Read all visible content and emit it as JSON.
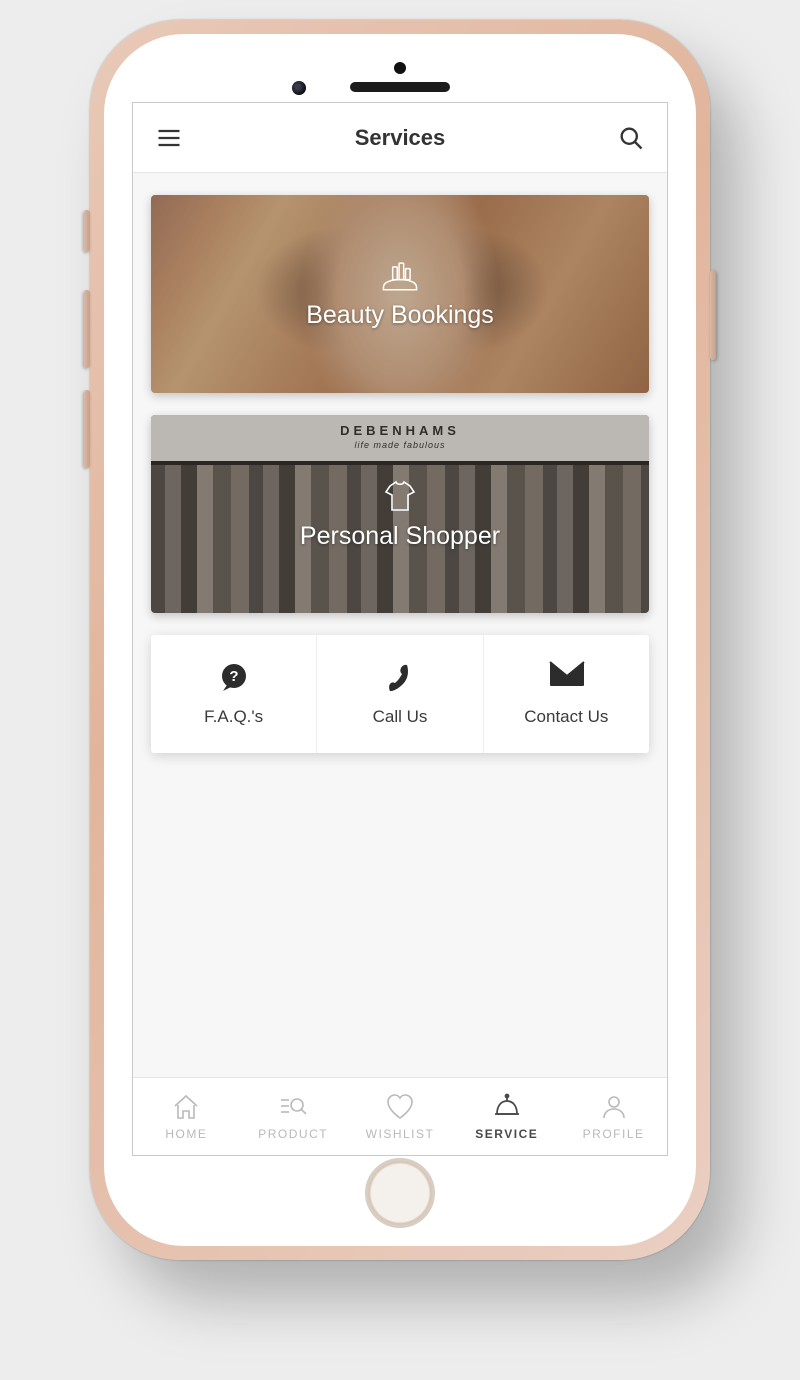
{
  "header": {
    "title": "Services"
  },
  "cards": [
    {
      "label": "Beauty Bookings",
      "icon": "cosmetics-icon"
    },
    {
      "label": "Personal Shopper",
      "icon": "shirt-icon",
      "brand": "DEBENHAMS",
      "tagline": "life made fabulous"
    }
  ],
  "actions": [
    {
      "label": "F.A.Q.'s",
      "icon": "faq-icon"
    },
    {
      "label": "Call Us",
      "icon": "phone-icon"
    },
    {
      "label": "Contact Us",
      "icon": "mail-icon"
    }
  ],
  "tabs": [
    {
      "label": "HOME",
      "icon": "home-icon",
      "active": false
    },
    {
      "label": "PRODUCT",
      "icon": "product-search-icon",
      "active": false
    },
    {
      "label": "WISHLIST",
      "icon": "heart-icon",
      "active": false
    },
    {
      "label": "SERVICE",
      "icon": "bell-icon",
      "active": true
    },
    {
      "label": "PROFILE",
      "icon": "profile-icon",
      "active": false
    }
  ]
}
